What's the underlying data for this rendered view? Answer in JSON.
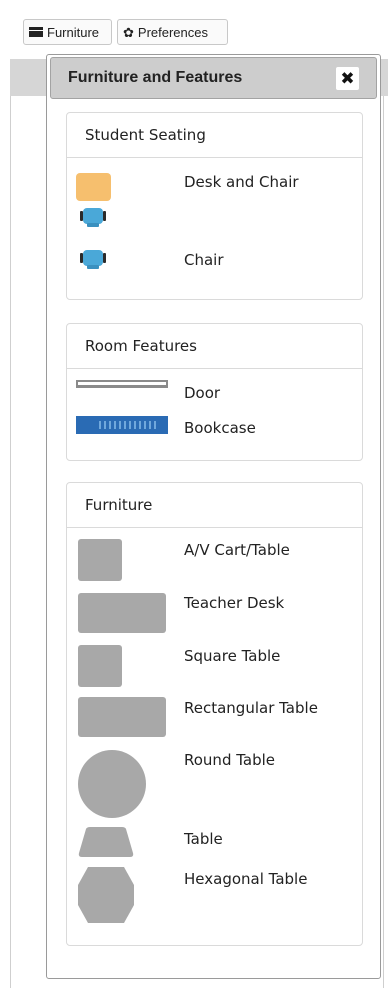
{
  "toolbar": {
    "furniture_label": "Furniture",
    "preferences_label": "Preferences"
  },
  "panel": {
    "title": "Furniture and Features",
    "close_glyph": "✖"
  },
  "sections": {
    "student_seating": {
      "heading": "Student Seating",
      "items": [
        "Desk and Chair",
        "Chair"
      ]
    },
    "room_features": {
      "heading": "Room Features",
      "items": [
        "Door",
        "Bookcase"
      ]
    },
    "furniture": {
      "heading": "Furniture",
      "items": [
        "A/V Cart/Table",
        "Teacher Desk",
        "Square Table",
        "Rectangular Table",
        "Round Table",
        "Table",
        "Hexagonal Table"
      ]
    }
  },
  "colors": {
    "desk": "#f6bf6e",
    "chair": "#4aa8d8",
    "furniture_grey": "#a8a8a8",
    "bookcase": "#2a6bb4"
  }
}
